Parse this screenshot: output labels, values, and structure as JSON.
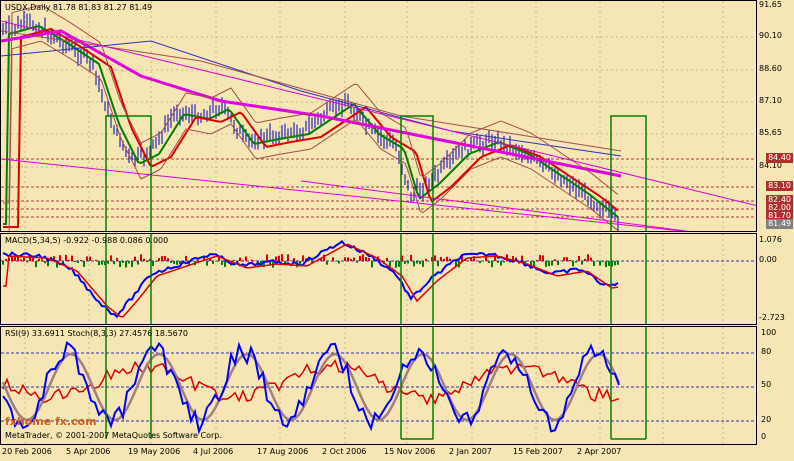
{
  "main": {
    "title": "USDX,Daily  81.78 81.83 81.27 81.49",
    "scale": [
      "91.65",
      "90.10",
      "88.60",
      "87.10",
      "85.65",
      "84.10",
      "82.65",
      "81.28"
    ],
    "markers": [
      {
        "label": "84.40",
        "color": "#b03030"
      },
      {
        "label": "83.10",
        "color": "#b03030"
      },
      {
        "label": "82.40",
        "color": "#b03030"
      },
      {
        "label": "82.00",
        "color": "#b03030"
      },
      {
        "label": "81.70",
        "color": "#b03030"
      },
      {
        "label": "81.49",
        "color": "#808080"
      }
    ]
  },
  "macd": {
    "title": "MACD(5,34,5)  -0.922 -0.988 0.086 0.000",
    "scale": [
      "1.076",
      "0.00",
      "-2.723"
    ]
  },
  "osc": {
    "title": "RSI(9) 33.6911  Stoch(8,3,3) 27.4576 18.5670",
    "scale": [
      "100",
      "80",
      "50",
      "20",
      "0"
    ]
  },
  "dates": [
    "20 Feb 2006",
    "5 Apr 2006",
    "19 May 2006",
    "4 Jul 2006",
    "17 Aug 2006",
    "2 Oct 2006",
    "15 Nov 2006",
    "2 Jan 2007",
    "15 Feb 2007",
    "2 Apr 2007"
  ],
  "watermark": {
    "line1": "MetaTrader, © 2001-2007 MetaQuotes Software Corp.",
    "line2": "fxhome fx.com"
  }
}
